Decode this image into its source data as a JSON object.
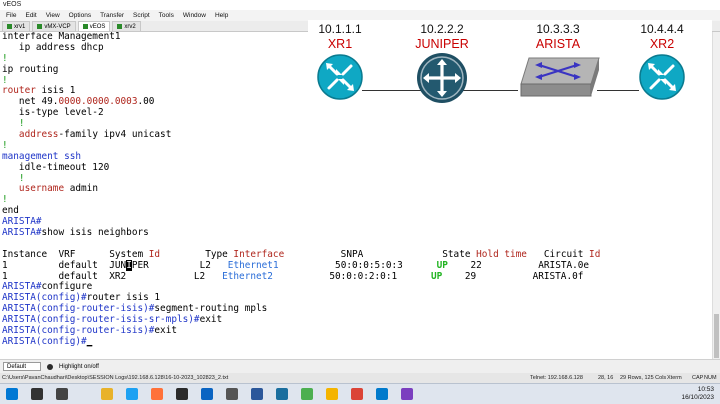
{
  "window": {
    "title": "vEOS"
  },
  "menu": [
    "File",
    "Edit",
    "View",
    "Options",
    "Transfer",
    "Script",
    "Tools",
    "Window",
    "Help"
  ],
  "tabs": [
    {
      "label": "xrv1",
      "active": false
    },
    {
      "label": "vMX-VCP",
      "active": false
    },
    {
      "label": "vEOS",
      "active": true
    },
    {
      "label": "xrv2",
      "active": false
    }
  ],
  "topology": {
    "nodes": [
      {
        "ip": "10.1.1.1",
        "name": "XR1",
        "icon": "router-icon"
      },
      {
        "ip": "10.2.2.2",
        "name": "JUNIPER",
        "icon": "juniper-router-icon"
      },
      {
        "ip": "10.3.3.3",
        "name": "ARISTA",
        "icon": "switch-icon"
      },
      {
        "ip": "10.4.4.4",
        "name": "XR2",
        "icon": "router-icon"
      }
    ],
    "colors": {
      "ip": "#111111",
      "name": "#c90000",
      "router": "#0fa8c4",
      "juniper": "#1f4f63",
      "switch": "#8a8a8a",
      "switch_arrows": "#3a34c2"
    }
  },
  "terminal": {
    "lines": [
      [
        {
          "t": "interface Management1"
        }
      ],
      [
        {
          "t": "   ip address dhcp"
        }
      ],
      [
        {
          "t": "!",
          "c": "green"
        }
      ],
      [
        {
          "t": "ip routing"
        }
      ],
      [
        {
          "t": "!",
          "c": "green"
        }
      ],
      [
        {
          "t": "router",
          "c": "red"
        },
        {
          "t": " isis 1"
        }
      ],
      [
        {
          "t": "   net 49."
        },
        {
          "t": "0000.0000.0003",
          "c": "red"
        },
        {
          "t": ".00"
        }
      ],
      [
        {
          "t": "   is-type level-2"
        }
      ],
      [
        {
          "t": "   !",
          "c": "green"
        }
      ],
      [
        {
          "t": "   address",
          "c": "red"
        },
        {
          "t": "-family ipv4 unicast"
        }
      ],
      [
        {
          "t": "!",
          "c": "green"
        }
      ],
      [
        {
          "t": "management ssh",
          "c": "blue"
        }
      ],
      [
        {
          "t": "   idle-timeout 120"
        }
      ],
      [
        {
          "t": "   !",
          "c": "green"
        }
      ],
      [
        {
          "t": "   username",
          "c": "red"
        },
        {
          "t": " admin"
        }
      ],
      [
        {
          "t": "!",
          "c": "green"
        }
      ],
      [
        {
          "t": "end"
        }
      ],
      [
        {
          "t": "ARISTA#",
          "c": "blue"
        }
      ],
      [
        {
          "t": "ARISTA#",
          "c": "blue"
        },
        {
          "t": "show isis neighbors"
        }
      ],
      [
        {
          "t": ""
        }
      ],
      [
        {
          "t": "Instance  VRF      System "
        },
        {
          "t": "Id",
          "c": "red"
        },
        {
          "t": "        Type "
        },
        {
          "t": "Interface",
          "c": "red"
        },
        {
          "t": "          SNPA              State "
        },
        {
          "t": "Hold time",
          "c": "red"
        },
        {
          "t": "   Circuit "
        },
        {
          "t": "Id",
          "c": "red"
        }
      ],
      [
        {
          "t": "1         default  JUN"
        },
        {
          "t": "I",
          "c": "cursor"
        },
        {
          "t": "PER         L2   "
        },
        {
          "t": "Ethernet1",
          "c": "ltblue"
        },
        {
          "t": "          50:0:0:5:0:3      "
        },
        {
          "t": "UP",
          "c": "bgreen"
        },
        {
          "t": "    22          ARISTA.0e"
        }
      ],
      [
        {
          "t": "1         default  XR2            L2   "
        },
        {
          "t": "Ethernet2",
          "c": "ltblue"
        },
        {
          "t": "          50:0:0:2:0:1      "
        },
        {
          "t": "UP",
          "c": "bgreen"
        },
        {
          "t": "    29          ARISTA.0f"
        }
      ],
      [
        {
          "t": "ARISTA#",
          "c": "blue"
        },
        {
          "t": "configure"
        }
      ],
      [
        {
          "t": "ARISTA(config)#",
          "c": "blue"
        },
        {
          "t": "router isis 1"
        }
      ],
      [
        {
          "t": "ARISTA(config-router-isis)#",
          "c": "blue"
        },
        {
          "t": "segment-routing mpls"
        }
      ],
      [
        {
          "t": "ARISTA(config-router-isis-sr-mpls)#",
          "c": "blue"
        },
        {
          "t": "exit"
        }
      ],
      [
        {
          "t": "ARISTA(config-router-isis)#",
          "c": "blue"
        },
        {
          "t": "exit"
        }
      ],
      [
        {
          "t": "ARISTA(config)#",
          "c": "blue"
        },
        {
          "t": "_",
          "c": "ucursor"
        }
      ]
    ]
  },
  "bottom": {
    "select_value": "Default",
    "highlight_label": "Highlight on/off"
  },
  "status": {
    "path": "C:\\Users\\PavanChaudhari\\Desktop\\SESSION Logs\\192.168.6.128\\16-10-2023_102823_2.txt",
    "telnet": "Telnet: 192.168.6.128",
    "pos": "28, 16",
    "size": "29 Rows, 125 Cols",
    "term": "Xterm",
    "caps": "CAP",
    "num": "NUM"
  },
  "taskbar": {
    "icons": [
      "windows-start-icon",
      "search-icon",
      "task-view-icon",
      "file-explorer-icon",
      "edge-icon",
      "firefox-icon",
      "terminal-icon",
      "mail-icon",
      "settings-icon",
      "word-icon",
      "network-app-icon",
      "gns3-icon",
      "notes-icon",
      "chrome-icon",
      "vscode-icon",
      "app-icon"
    ],
    "time": "10:53",
    "date": "16/10/2023"
  }
}
